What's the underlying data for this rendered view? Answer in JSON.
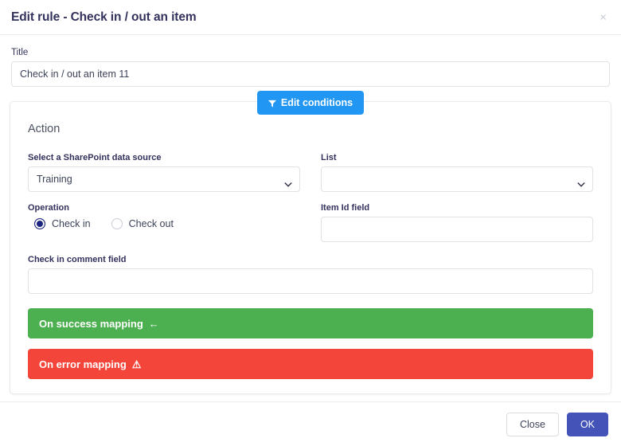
{
  "dialog": {
    "title": "Edit rule - Check in / out an item",
    "close_icon": "close-icon",
    "close_symbol": "×"
  },
  "title_field": {
    "label": "Title",
    "value": "Check in / out an item 11",
    "placeholder": ""
  },
  "edit_conditions": {
    "label": "Edit conditions",
    "icon": "filter-funnel-icon",
    "color": "#2196f3"
  },
  "action": {
    "heading": "Action",
    "data_source": {
      "label": "Select a SharePoint data source",
      "value": "Training",
      "options": [
        "Training"
      ]
    },
    "list": {
      "label": "List",
      "value": "",
      "options": [
        ""
      ]
    },
    "operation": {
      "label": "Operation",
      "options": [
        {
          "label": "Check in",
          "selected": true
        },
        {
          "label": "Check out",
          "selected": false
        }
      ]
    },
    "item_id_field": {
      "label": "Item Id field",
      "value": "",
      "placeholder": ""
    },
    "comment_field": {
      "label": "Check in comment field",
      "value": "",
      "placeholder": ""
    }
  },
  "mappings": {
    "success": {
      "label": "On success mapping",
      "icon": "arrow-left-icon",
      "symbol": "←",
      "color": "#4caf50"
    },
    "error": {
      "label": "On error mapping",
      "icon": "warning-triangle-icon",
      "symbol": "⚠",
      "color": "#f4453a"
    }
  },
  "footer": {
    "close_label": "Close",
    "ok_label": "OK",
    "ok_color": "#4353b8"
  }
}
